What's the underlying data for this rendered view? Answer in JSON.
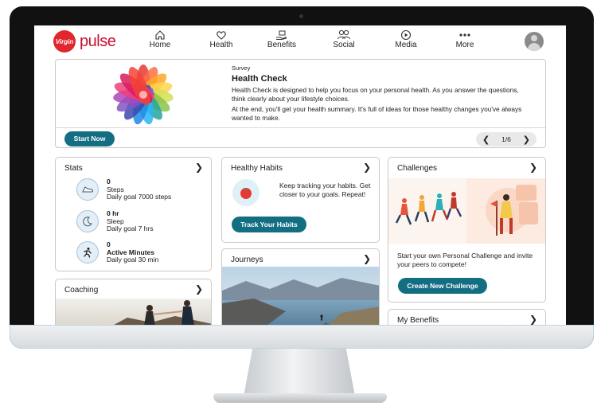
{
  "app": {
    "brand_prefix": "Virgin",
    "brand_name": "pulse"
  },
  "nav": [
    {
      "label": "Home",
      "icon": "home-icon"
    },
    {
      "label": "Health",
      "icon": "heart-icon"
    },
    {
      "label": "Benefits",
      "icon": "gift-hand-icon"
    },
    {
      "label": "Social",
      "icon": "people-icon"
    },
    {
      "label": "Media",
      "icon": "play-circle-icon"
    },
    {
      "label": "More",
      "icon": "more-dots-icon"
    }
  ],
  "survey": {
    "kicker": "Survey",
    "title": "Health Check",
    "p1": "Health Check is designed to help you focus on your personal health. As you answer the questions, think clearly about your lifestyle choices.",
    "p2": "At the end, you'll get your health summary. It's full of ideas for those healthy changes you've always wanted to make.",
    "cta": "Start Now",
    "pager": "1/6"
  },
  "stats": {
    "title": "Stats",
    "items": [
      {
        "value": "0",
        "label": "Steps",
        "goal": "Daily goal 7000 steps",
        "icon": "shoe-icon"
      },
      {
        "value": "0 hr",
        "label": "Sleep",
        "goal": "Daily goal 7 hrs",
        "icon": "moon-icon"
      },
      {
        "value": "0",
        "label": "Active Minutes",
        "goal": "Daily goal 30 min",
        "icon": "running-icon"
      }
    ]
  },
  "habits": {
    "title": "Healthy Habits",
    "text": "Keep tracking your habits. Get closer to your goals. Repeat!",
    "cta": "Track Your Habits"
  },
  "journeys": {
    "title": "Journeys"
  },
  "challenges": {
    "title": "Challenges",
    "text": "Start your own Personal Challenge and invite your peers to compete!",
    "cta": "Create New Challenge"
  },
  "coaching": {
    "title": "Coaching"
  },
  "benefits": {
    "title": "My Benefits"
  },
  "colors": {
    "brand": "#e1262d",
    "accent": "#146e82"
  }
}
